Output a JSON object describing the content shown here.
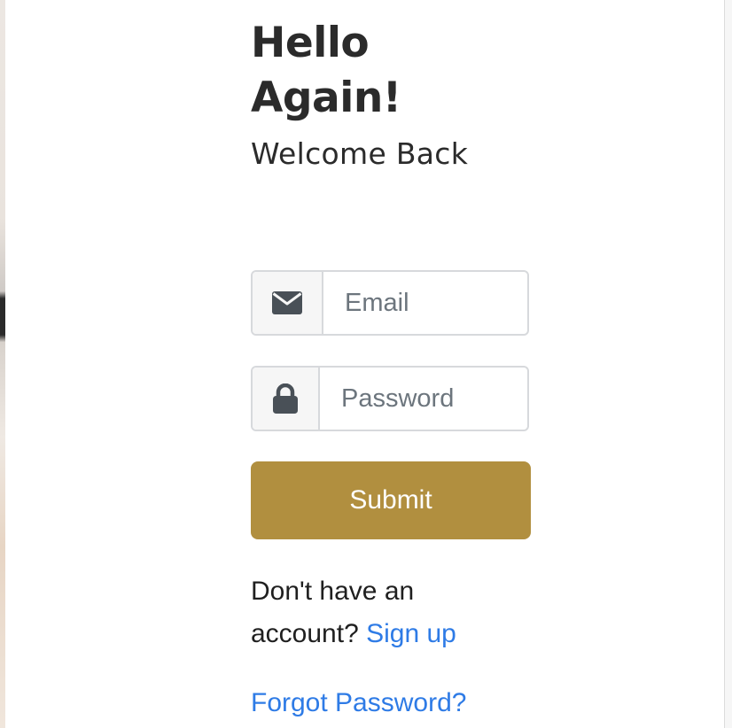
{
  "header": {
    "title": "Hello Again!",
    "subtitle": "Welcome Back"
  },
  "form": {
    "email": {
      "placeholder": "Email",
      "value": "",
      "icon": "envelope-icon"
    },
    "password": {
      "placeholder": "Password",
      "value": "",
      "icon": "lock-icon"
    },
    "submit_label": "Submit"
  },
  "footer": {
    "signup_prompt": "Don't have an account?",
    "signup_link": "Sign up",
    "forgot_link": "Forgot Password?"
  },
  "colors": {
    "accent": "#b18f3f",
    "link": "#2e7be6",
    "text": "#2b2b2b"
  }
}
